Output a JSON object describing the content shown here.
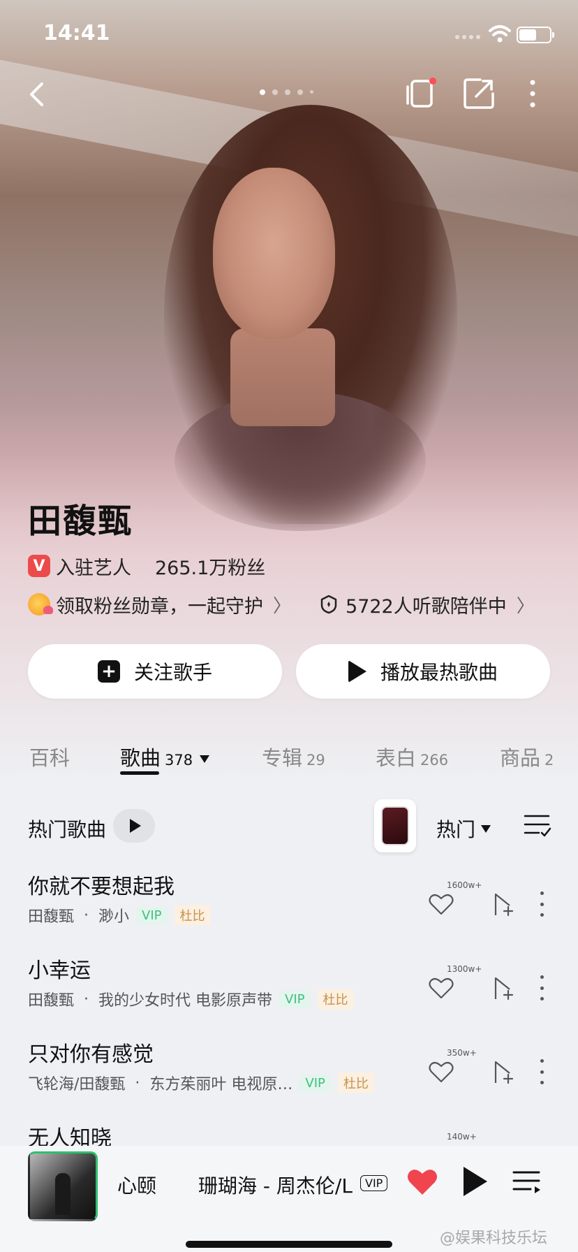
{
  "status_bar": {
    "time": "14:41"
  },
  "artist": {
    "name": "田馥甄",
    "badge_letter": "V",
    "verified_label": "入驻艺人",
    "fans": "265.1万粉丝",
    "medal_text": "领取粉丝勋章，一起守护",
    "companion_text": "5722人听歌陪伴中"
  },
  "actions": {
    "follow_label": "关注歌手",
    "play_hot_label": "播放最热歌曲"
  },
  "tabs": [
    {
      "label": "百科",
      "count": ""
    },
    {
      "label": "歌曲",
      "count": "378"
    },
    {
      "label": "专辑",
      "count": "29"
    },
    {
      "label": "表白",
      "count": "266"
    },
    {
      "label": "商品",
      "count": "2"
    }
  ],
  "list_header": {
    "hot_label": "热门歌曲",
    "sort_label": "热门"
  },
  "songs": [
    {
      "title": "你就不要想起我",
      "artist": "田馥甄",
      "album": "渺小",
      "likes": "1600w+",
      "vip": "VIP",
      "dolby": "杜比"
    },
    {
      "title": "小幸运",
      "artist": "田馥甄",
      "album": "我的少女时代 电影原声带",
      "likes": "1300w+",
      "vip": "VIP",
      "dolby": "杜比"
    },
    {
      "title": "只对你有感觉",
      "artist": "飞轮海/田馥甄",
      "album": "东方茱丽叶 电视原…",
      "likes": "350w+",
      "vip": "VIP",
      "dolby": "杜比"
    },
    {
      "title": "无人知晓",
      "artist": "",
      "album": "",
      "likes": "140w+",
      "vip": "",
      "dolby": ""
    }
  ],
  "player": {
    "title": "心颐",
    "song": "珊瑚海 - 周杰伦/L",
    "vip": "VIP"
  },
  "watermark": "@娱果科技乐坛",
  "colors": {
    "vip": "#3fbf83",
    "dolby": "#c8924a",
    "like": "#f0444f",
    "verified": "#ec4b4b"
  }
}
